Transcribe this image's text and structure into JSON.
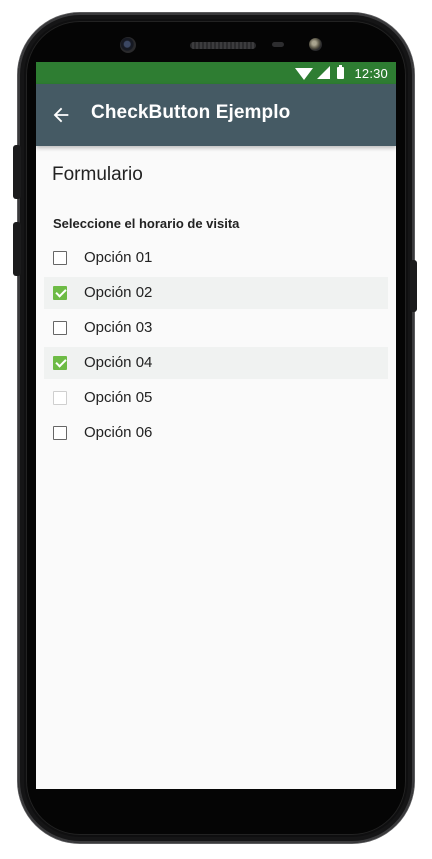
{
  "status_bar": {
    "time": "12:30",
    "icons": [
      "wifi-icon",
      "signal-icon",
      "battery-icon"
    ]
  },
  "app_bar": {
    "title": "CheckButton Ejemplo",
    "back_icon": "arrow-back-icon"
  },
  "form": {
    "heading": "Formulario",
    "subheading": "Seleccione el horario de visita",
    "options": [
      {
        "label": "Opción 01",
        "checked": false,
        "enabled": true
      },
      {
        "label": "Opción 02",
        "checked": true,
        "enabled": true
      },
      {
        "label": "Opción 03",
        "checked": false,
        "enabled": true
      },
      {
        "label": "Opción 04",
        "checked": true,
        "enabled": true
      },
      {
        "label": "Opción 05",
        "checked": false,
        "enabled": false
      },
      {
        "label": "Opción 06",
        "checked": false,
        "enabled": true
      }
    ]
  },
  "colors": {
    "status_bar": "#2e7d32",
    "app_bar": "#455a64",
    "accent": "#6dbb45"
  }
}
